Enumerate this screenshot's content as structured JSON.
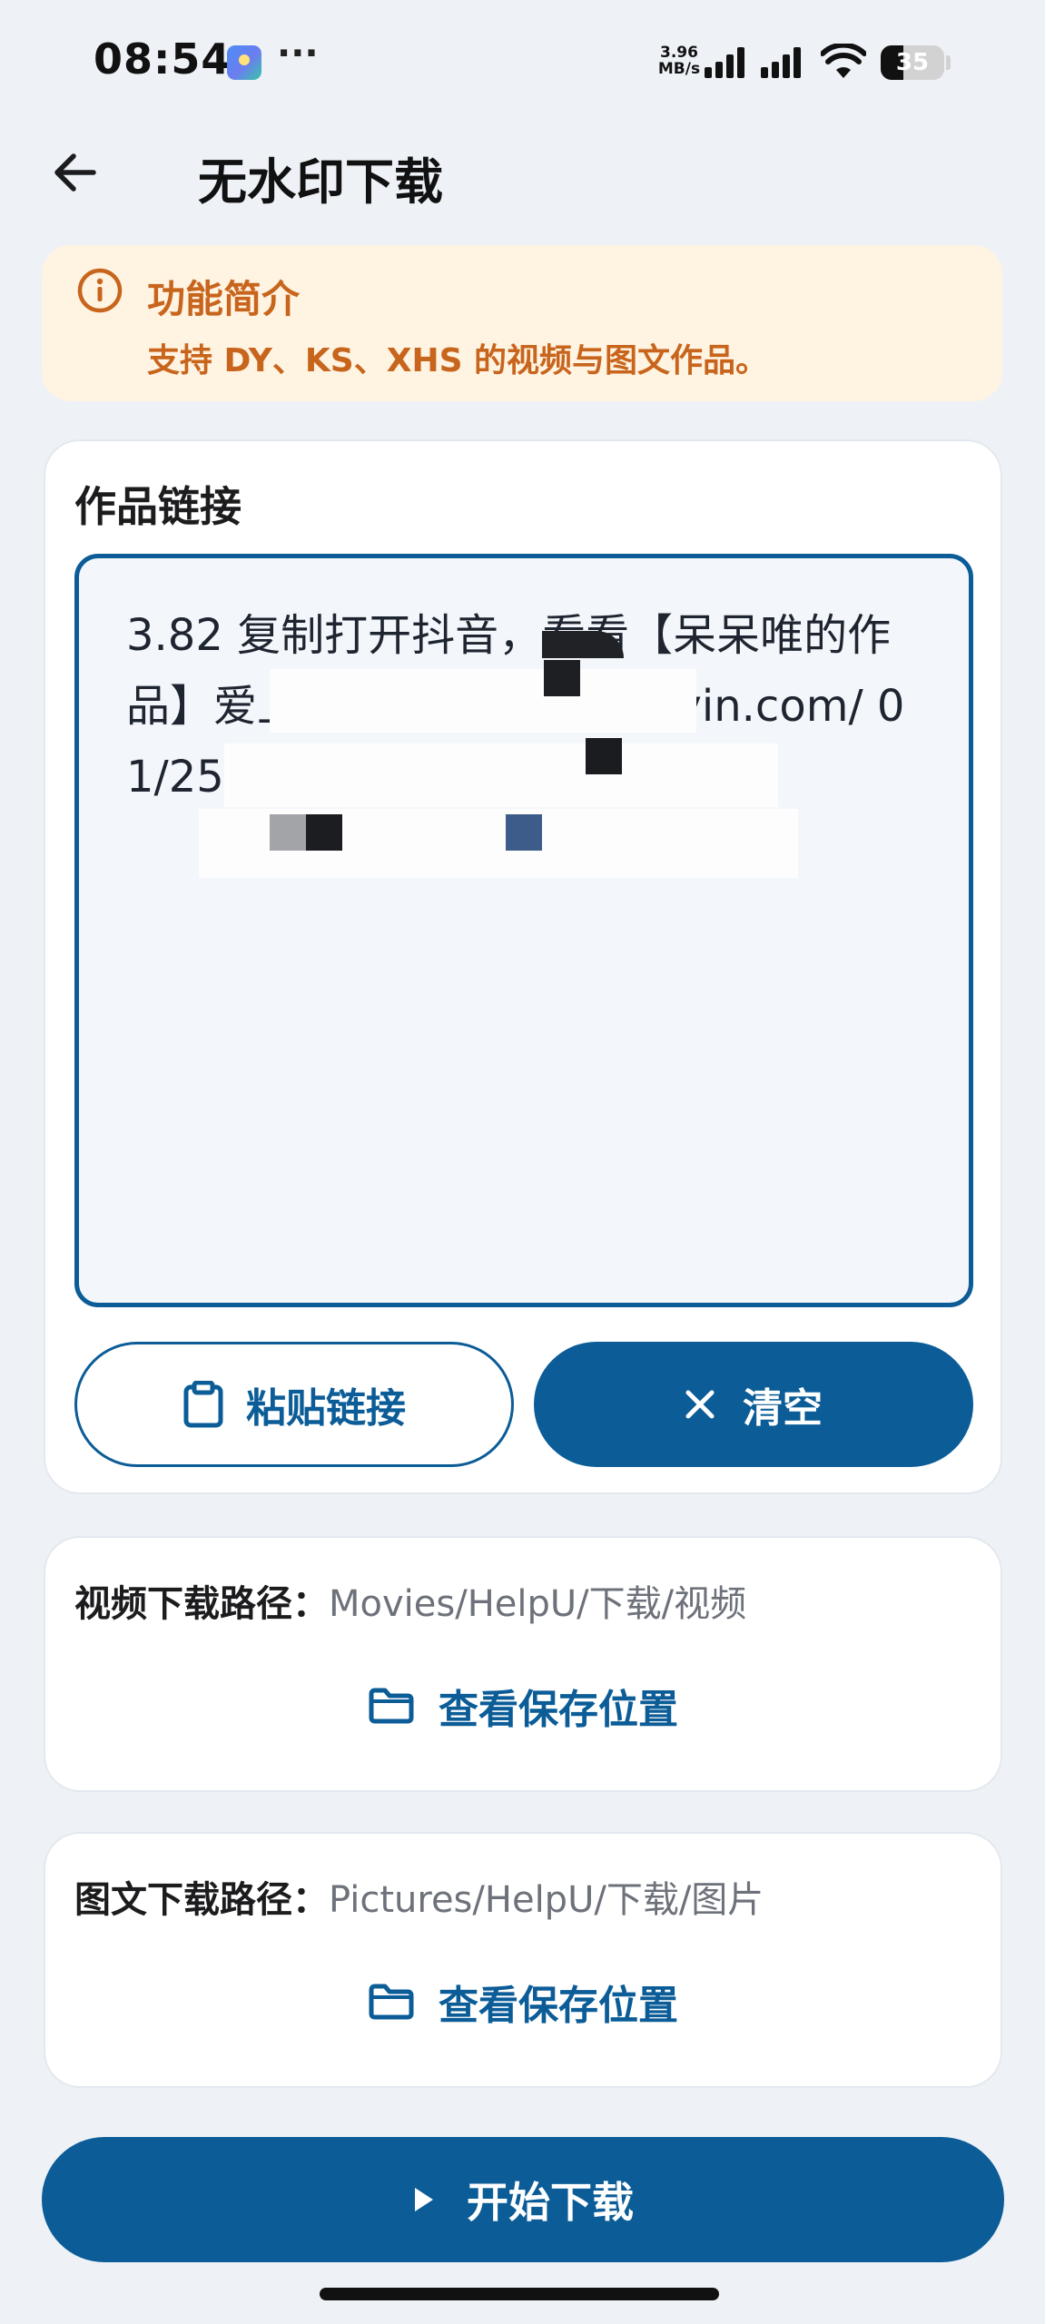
{
  "status_bar": {
    "time": "08:54",
    "more": "···",
    "net_speed_value": "3.96",
    "net_speed_unit": "MB/s",
    "battery": "35",
    "battery_level": 0.35
  },
  "app_bar": {
    "title": "无水印下载",
    "back_icon": "arrow-left-icon"
  },
  "intro": {
    "icon": "info-icon",
    "title": "功能简介",
    "text": "支持 DY、KS、XHS 的视频与图文作品。"
  },
  "link_card": {
    "label": "作品链接",
    "input_value": "3.82 复制打开抖音，看看【呆呆唯的作品】爱上了你  https://v.douyin.com/  01/25 :8p",
    "paste_label": "粘贴链接",
    "clear_label": "清空"
  },
  "video_path": {
    "label": "视频下载路径：",
    "value": "Movies/HelpU/下载/视频",
    "view_label": "查看保存位置"
  },
  "image_path": {
    "label": "图文下载路径：",
    "value": "Pictures/HelpU/下载/图片",
    "view_label": "查看保存位置"
  },
  "start_label": "开始下载",
  "colors": {
    "primary": "#0b5c97",
    "warning": "#c8651d",
    "warning_bg": "#fff3e2",
    "background": "#eef2f7"
  }
}
